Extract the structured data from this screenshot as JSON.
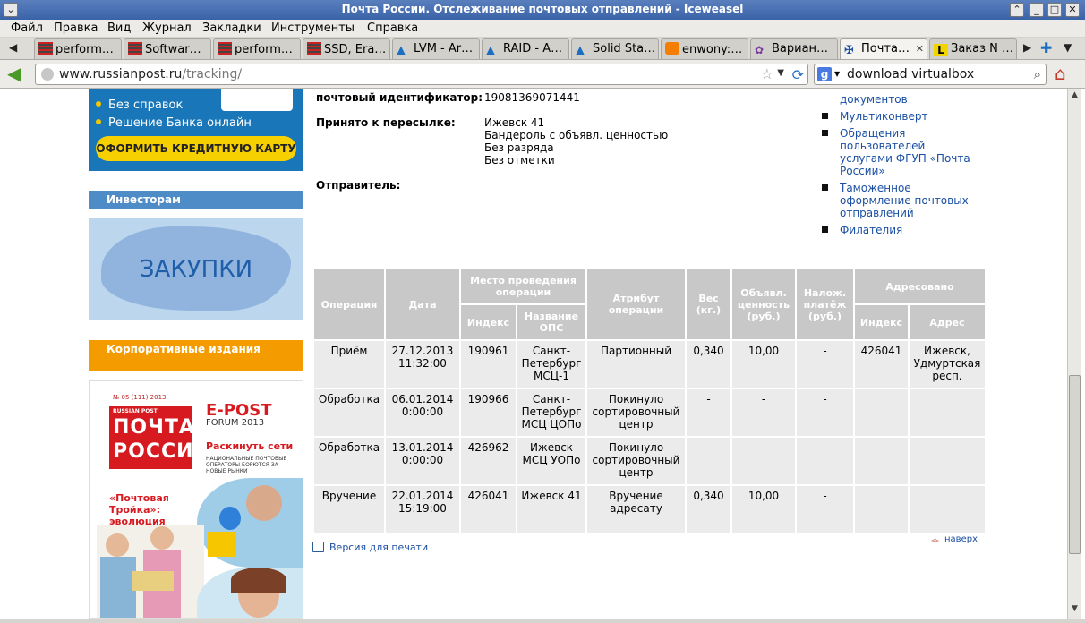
{
  "window": {
    "title": "Почта России. Отслеживание почтовых отправлений - Iceweasel"
  },
  "menu": [
    "Файл",
    "Правка",
    "Вид",
    "Журнал",
    "Закладки",
    "Инструменты",
    "Справка"
  ],
  "tabs": [
    {
      "label": "perform…",
      "icon": "bar-chart-icon"
    },
    {
      "label": "Softwar…",
      "icon": "bar-chart-icon"
    },
    {
      "label": "perform…",
      "icon": "bar-chart-icon"
    },
    {
      "label": "SSD, Era…",
      "icon": "bar-chart-icon"
    },
    {
      "label": "LVM - Ar…",
      "icon": "arch-icon"
    },
    {
      "label": "RAID - A…",
      "icon": "arch-icon"
    },
    {
      "label": "Solid Sta…",
      "icon": "arch-icon"
    },
    {
      "label": "enwony:…",
      "icon": "blogger-icon"
    },
    {
      "label": "Вариан…",
      "icon": "puzzle-icon"
    },
    {
      "label": "Почта…",
      "icon": "eagle-icon",
      "active": true
    },
    {
      "label": "Заказ N …",
      "icon": "l-icon"
    }
  ],
  "navbar": {
    "url_host": "www.russianpost.ru",
    "url_path": "/tracking/",
    "search_value": "download virtualbox",
    "search_engine": "g"
  },
  "left": {
    "credit_lines": [
      "Без справок",
      "Решение Банка онлайн"
    ],
    "credit_button": "ОФОРМИТЬ КРЕДИТНУЮ КАРТУ",
    "investors": "Инвесторам",
    "zakupki": "ЗАКУПКИ",
    "corporate": "Корпоративные издания",
    "magazine": {
      "issue": "№ 05 (111) 2013",
      "brand_small": "RUSSIAN POST",
      "logo_line1": "ПОЧТА",
      "logo_line2": "РОССИИ",
      "epost": "E-POST",
      "forum": "FORUM 2013",
      "headline1": "Раскинуть сети",
      "sub1": "НАЦИОНАЛЬНЫЕ ПОЧТОВЫЕ ОПЕРАТОРЫ БОРЮТСЯ ЗА НОВЫЕ РЫНКИ",
      "headline2": "«Почтовая Тройка»: эволюция"
    }
  },
  "info": {
    "identifier_label": "почтовый идентификатор:",
    "identifier_value": "19081369071441",
    "accepted_label": "Принято к пересылке:",
    "accepted_lines": [
      "Ижевск 41",
      "Бандероль с объявл. ценностью",
      "Без разряда",
      "Без отметки"
    ],
    "sender_label": "Отправитель:"
  },
  "right_links": [
    "документов",
    "Мультиконверт",
    "Обращения пользователей услугами ФГУП «Почта России»",
    "Таможенное оформление почтовых отправлений",
    "Филателия"
  ],
  "table": {
    "headers": {
      "operation": "Операция",
      "date": "Дата",
      "place": "Место проведения операции",
      "index": "Индекс",
      "ops_name": "Название ОПС",
      "attribute": "Атрибут операции",
      "weight": "Вес (кг.)",
      "declared": "Объявл. ценность (руб.)",
      "cod": "Налож. платёж (руб.)",
      "addressed": "Адресовано",
      "addr_index": "Индекс",
      "address": "Адрес"
    },
    "rows": [
      {
        "op": "Приём",
        "date": "27.12.2013 11:32:00",
        "index": "190961",
        "ops": "Санкт-Петербург МСЦ-1",
        "attr": "Партионный",
        "weight": "0,340",
        "declared": "10,00",
        "cod": "-",
        "addr_index": "426041",
        "address": "Ижевск, Удмуртская респ."
      },
      {
        "op": "Обработка",
        "date": "06.01.2014 0:00:00",
        "index": "190966",
        "ops": "Санкт-Петербург МСЦ ЦОПо",
        "attr": "Покинуло сортировочный центр",
        "weight": "-",
        "declared": "-",
        "cod": "-",
        "addr_index": "",
        "address": ""
      },
      {
        "op": "Обработка",
        "date": "13.01.2014 0:00:00",
        "index": "426962",
        "ops": "Ижевск МСЦ УОПо",
        "attr": "Покинуло сортировочный центр",
        "weight": "-",
        "declared": "-",
        "cod": "-",
        "addr_index": "",
        "address": ""
      },
      {
        "op": "Вручение",
        "date": "22.01.2014 15:19:00",
        "index": "426041",
        "ops": "Ижевск 41",
        "attr": "Вручение адресату",
        "weight": "0,340",
        "declared": "10,00",
        "cod": "-",
        "addr_index": "",
        "address": ""
      }
    ]
  },
  "print_link": "Версия для печати",
  "top_link": "наверх"
}
